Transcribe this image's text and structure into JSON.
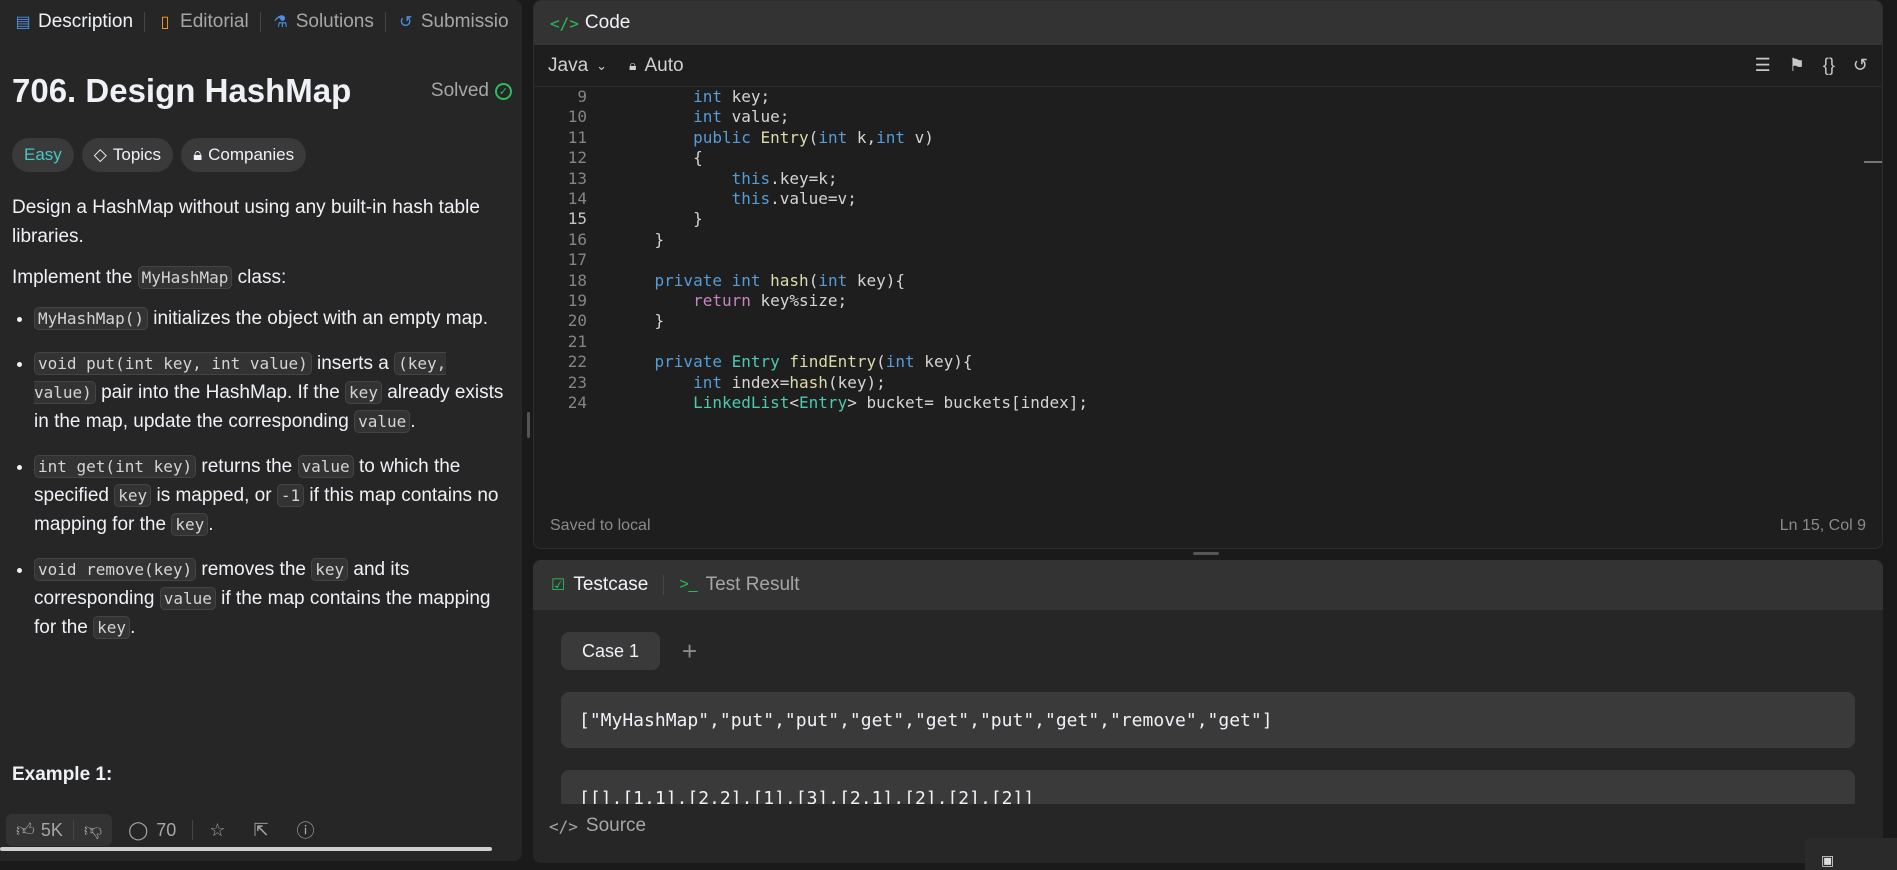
{
  "tabs": [
    {
      "label": "Description",
      "icon": "description-icon"
    },
    {
      "label": "Editorial",
      "icon": "book-icon"
    },
    {
      "label": "Solutions",
      "icon": "flask-icon"
    },
    {
      "label": "Submissio",
      "icon": "history-icon"
    }
  ],
  "problem": {
    "title": "706. Design HashMap",
    "status": "Solved",
    "difficulty": "Easy",
    "topics_label": "Topics",
    "companies_label": "Companies",
    "example_heading": "Example 1:"
  },
  "description": {
    "p1": "Design a HashMap without using any built-in hash table libraries.",
    "p2_pre": "Implement the ",
    "p2_code": "MyHashMap",
    "p2_post": " class:",
    "b1_code": "MyHashMap()",
    "b1_text": " initializes the object with an empty map.",
    "b2_code1": "void put(int key, int value)",
    "b2_t1": " inserts a ",
    "b2_code2": "(key, value)",
    "b2_t2": " pair into the HashMap. If the ",
    "b2_code3": "key",
    "b2_t3": " already exists in the map, update the corresponding ",
    "b2_code4": "value",
    "b2_t4": ".",
    "b3_code1": "int get(int key)",
    "b3_t1": " returns the ",
    "b3_code2": "value",
    "b3_t2": " to which the specified ",
    "b3_code3": "key",
    "b3_t3": " is mapped, or ",
    "b3_code4": "-1",
    "b3_t4": " if this map contains no mapping for the ",
    "b3_code5": "key",
    "b3_t5": ".",
    "b4_code1": "void remove(key)",
    "b4_t1": " removes the ",
    "b4_code2": "key",
    "b4_t2": " and its corresponding ",
    "b4_code3": "value",
    "b4_t3": " if the map contains the mapping for the ",
    "b4_code4": "key",
    "b4_t4": "."
  },
  "footer": {
    "likes": "5K",
    "comments": "70"
  },
  "code_panel": {
    "title": "Code",
    "language": "Java",
    "mode": "Auto",
    "saved": "Saved to local",
    "cursor": "Ln 15, Col 9"
  },
  "code_lines": [
    {
      "n": "9",
      "t": "        int key;"
    },
    {
      "n": "10",
      "t": "        int value;"
    },
    {
      "n": "11",
      "t": "        public Entry(int k,int v)"
    },
    {
      "n": "12",
      "t": "        {"
    },
    {
      "n": "13",
      "t": "            this.key=k;"
    },
    {
      "n": "14",
      "t": "            this.value=v;"
    },
    {
      "n": "15",
      "t": "        }"
    },
    {
      "n": "16",
      "t": "    }"
    },
    {
      "n": "17",
      "t": ""
    },
    {
      "n": "18",
      "t": "    private int hash(int key){"
    },
    {
      "n": "19",
      "t": "        return key%size;"
    },
    {
      "n": "20",
      "t": "    }"
    },
    {
      "n": "21",
      "t": ""
    },
    {
      "n": "22",
      "t": "    private Entry findEntry(int key){"
    },
    {
      "n": "23",
      "t": "        int index=hash(key);"
    },
    {
      "n": "24",
      "t": "        LinkedList<Entry> bucket= buckets[index];"
    }
  ],
  "test_panel": {
    "testcase_label": "Testcase",
    "result_label": "Test Result",
    "case_label": "Case 1",
    "input1": "[\"MyHashMap\",\"put\",\"put\",\"get\",\"get\",\"put\",\"get\",\"remove\",\"get\"]",
    "input2": "[[],[1,1],[2,2],[1],[3],[2,1],[2],[2],[2]]",
    "source_label": "Source"
  }
}
